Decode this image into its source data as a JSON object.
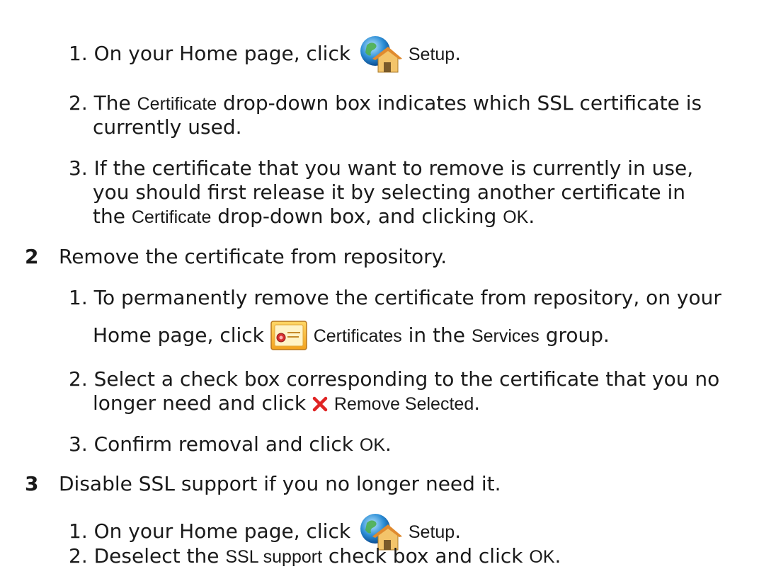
{
  "section1": {
    "items": [
      {
        "n": "1.",
        "t1": "On your Home page, click ",
        "ui1": "Setup",
        "t2": "."
      },
      {
        "n": "2.",
        "t1": "The ",
        "ui1": "Certificate",
        "t2": " drop-down box indicates which SSL certificate is",
        "l2": "currently used."
      },
      {
        "n": "3.",
        "l1": "If the certificate that you want to remove is currently in use,",
        "l2": "you should first release it by selecting another certificate in",
        "l3a": "the ",
        "ui1": "Certificate",
        "l3b": " drop-down box, and clicking ",
        "ui2": "OK",
        "l3c": "."
      }
    ]
  },
  "step2": {
    "number": "2",
    "title": "Remove the certificate from repository.",
    "items": [
      {
        "n": "1.",
        "l1": "To permanently remove the certificate from repository, on your",
        "l2a": "Home page, click ",
        "ui1": "Certificates",
        "l2b": " in the ",
        "ui2": "Services",
        "l2c": " group."
      },
      {
        "n": "2.",
        "l1": "Select a check box corresponding to the certificate that you no",
        "l2a": "longer need and click ",
        "ui1": "Remove Selected",
        "l2b": "."
      },
      {
        "n": "3.",
        "t1": "Confirm removal and click ",
        "ui1": "OK",
        "t2": "."
      }
    ]
  },
  "step3": {
    "number": "3",
    "title": "Disable SSL support if you no longer need it.",
    "items": [
      {
        "n": "1.",
        "t1": "On your Home page, click ",
        "ui1": "Setup",
        "t2": "."
      },
      {
        "n": "2.",
        "t1": "Deselect the ",
        "ui1": "SSL support",
        "t2": " check box and click ",
        "ui2": "OK",
        "t3": "."
      }
    ]
  },
  "icons": {
    "setup": "setup-globe-house-icon",
    "certificates": "certificate-icon",
    "remove": "red-x-remove-icon"
  }
}
